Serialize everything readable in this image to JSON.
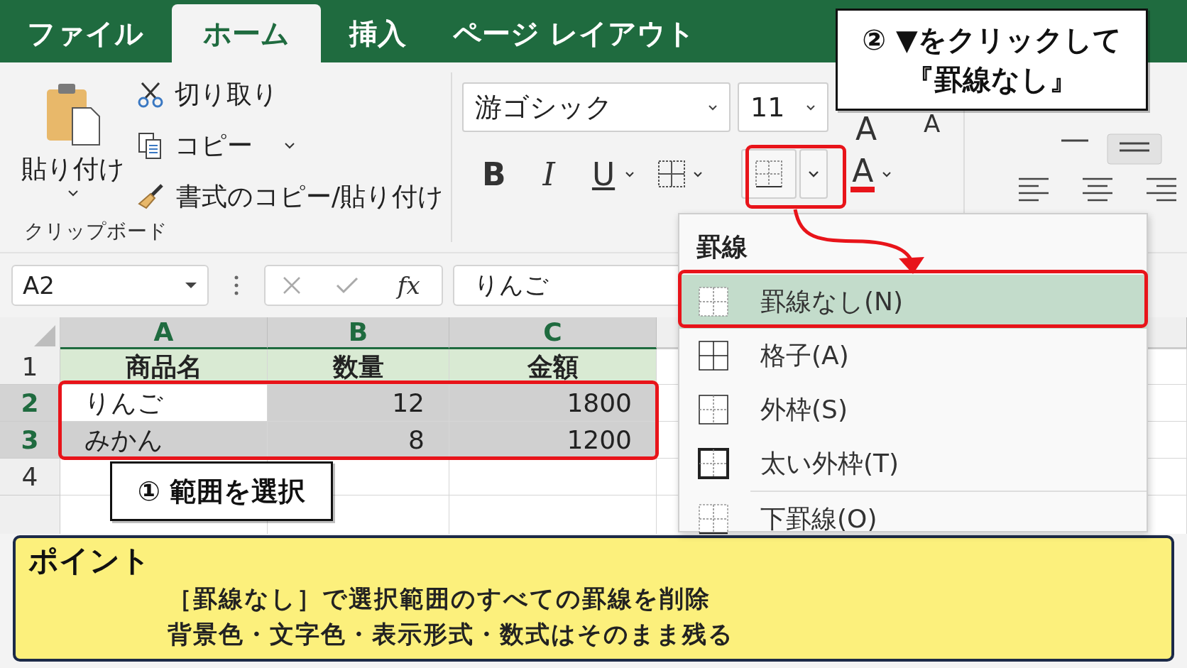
{
  "tabs": [
    {
      "label": "ファイル",
      "selected": false
    },
    {
      "label": "ホーム",
      "selected": true
    },
    {
      "label": "挿入",
      "selected": false
    },
    {
      "label": "ページ レイアウト",
      "selected": false
    }
  ],
  "clipboard": {
    "paste": "貼り付け",
    "cut": "切り取り",
    "copy": "コピー",
    "format_painter": "書式のコピー/貼り付け",
    "group_label": "クリップボード"
  },
  "font": {
    "name": "游ゴシック",
    "size": "11",
    "grow": "A",
    "shrink": "A",
    "bold": "B",
    "italic": "I",
    "underline": "U",
    "font_color": "A"
  },
  "formula_bar": {
    "name_box": "A2",
    "fx_label": "fx",
    "value": "りんご"
  },
  "sheet": {
    "columns": [
      {
        "label": "A",
        "selected": true
      },
      {
        "label": "B",
        "selected": true
      },
      {
        "label": "C",
        "selected": true
      }
    ],
    "rows": [
      {
        "number": "1",
        "selected": false,
        "kind": "header",
        "cells": [
          {
            "text": "商品名",
            "kind": "text",
            "active": false
          },
          {
            "text": "数量",
            "kind": "text",
            "active": false
          },
          {
            "text": "金額",
            "kind": "text",
            "active": false
          }
        ]
      },
      {
        "number": "2",
        "selected": true,
        "kind": "data",
        "cells": [
          {
            "text": "りんご",
            "kind": "text",
            "active": true
          },
          {
            "text": "12",
            "kind": "number",
            "active": false
          },
          {
            "text": "1800",
            "kind": "number",
            "active": false
          }
        ]
      },
      {
        "number": "3",
        "selected": true,
        "kind": "data",
        "cells": [
          {
            "text": "みかん",
            "kind": "text",
            "active": false
          },
          {
            "text": "8",
            "kind": "number",
            "active": false
          },
          {
            "text": "1200",
            "kind": "number",
            "active": false
          }
        ]
      },
      {
        "number": "4",
        "selected": false,
        "kind": "data",
        "cells": []
      }
    ]
  },
  "border_menu": {
    "title": "罫線",
    "items": [
      {
        "label": "罫線なし(N)",
        "kind": "none",
        "selected": true
      },
      {
        "label": "格子(A)",
        "kind": "all",
        "selected": false
      },
      {
        "label": "外枠(S)",
        "kind": "outside",
        "selected": false
      },
      {
        "label": "太い外枠(T)",
        "kind": "thick",
        "selected": false
      },
      {
        "label": "下罫線(O)",
        "kind": "bottom",
        "selected": false
      }
    ]
  },
  "callouts": [
    {
      "lines": [
        "② ▼をクリックして",
        "『罫線なし』"
      ]
    },
    {
      "lines": [
        "① 範囲を選択"
      ]
    }
  ],
  "point": {
    "heading": "ポイント",
    "lines": [
      "［罫線なし］で選択範囲のすべての罫線を削除",
      "背景色・文字色・表示形式・数式はそのまま残る"
    ]
  }
}
